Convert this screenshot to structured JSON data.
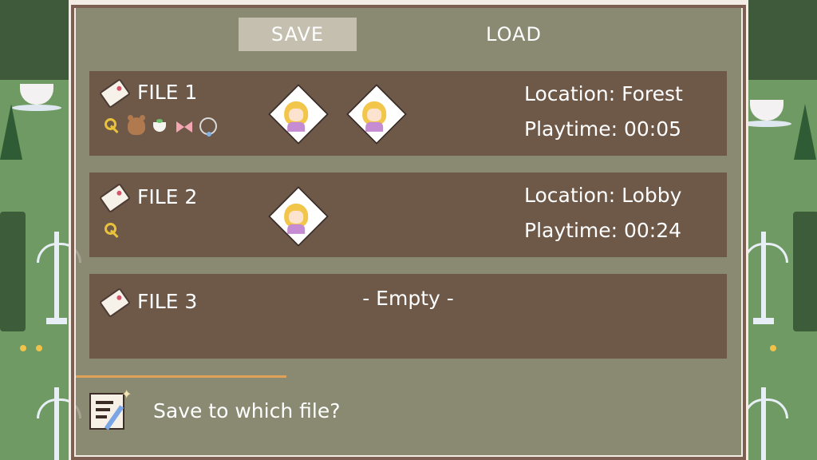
{
  "tabs": [
    {
      "label": "SAVE",
      "active": true
    },
    {
      "label": "LOAD",
      "active": false
    }
  ],
  "slots": [
    {
      "name": "FILE 1",
      "items": [
        "key-icon",
        "teddy-bear-icon",
        "teacup-icon",
        "bow-icon",
        "necklace-icon"
      ],
      "portraits": 2,
      "location": "Location: Forest",
      "playtime": "Playtime: 00:05"
    },
    {
      "name": "FILE 2",
      "items": [
        "key-icon"
      ],
      "portraits": 1,
      "location": "Location: Lobby",
      "playtime": "Playtime: 00:24"
    },
    {
      "name": "FILE 3",
      "empty_text": "- Empty -"
    }
  ],
  "message": {
    "text": "Save to which file?",
    "icon": "save-memo-icon"
  },
  "colors": {
    "slot_bg": "#6e5848",
    "tab_active": "#cec8ba",
    "accent_line": "#e0a25a"
  }
}
